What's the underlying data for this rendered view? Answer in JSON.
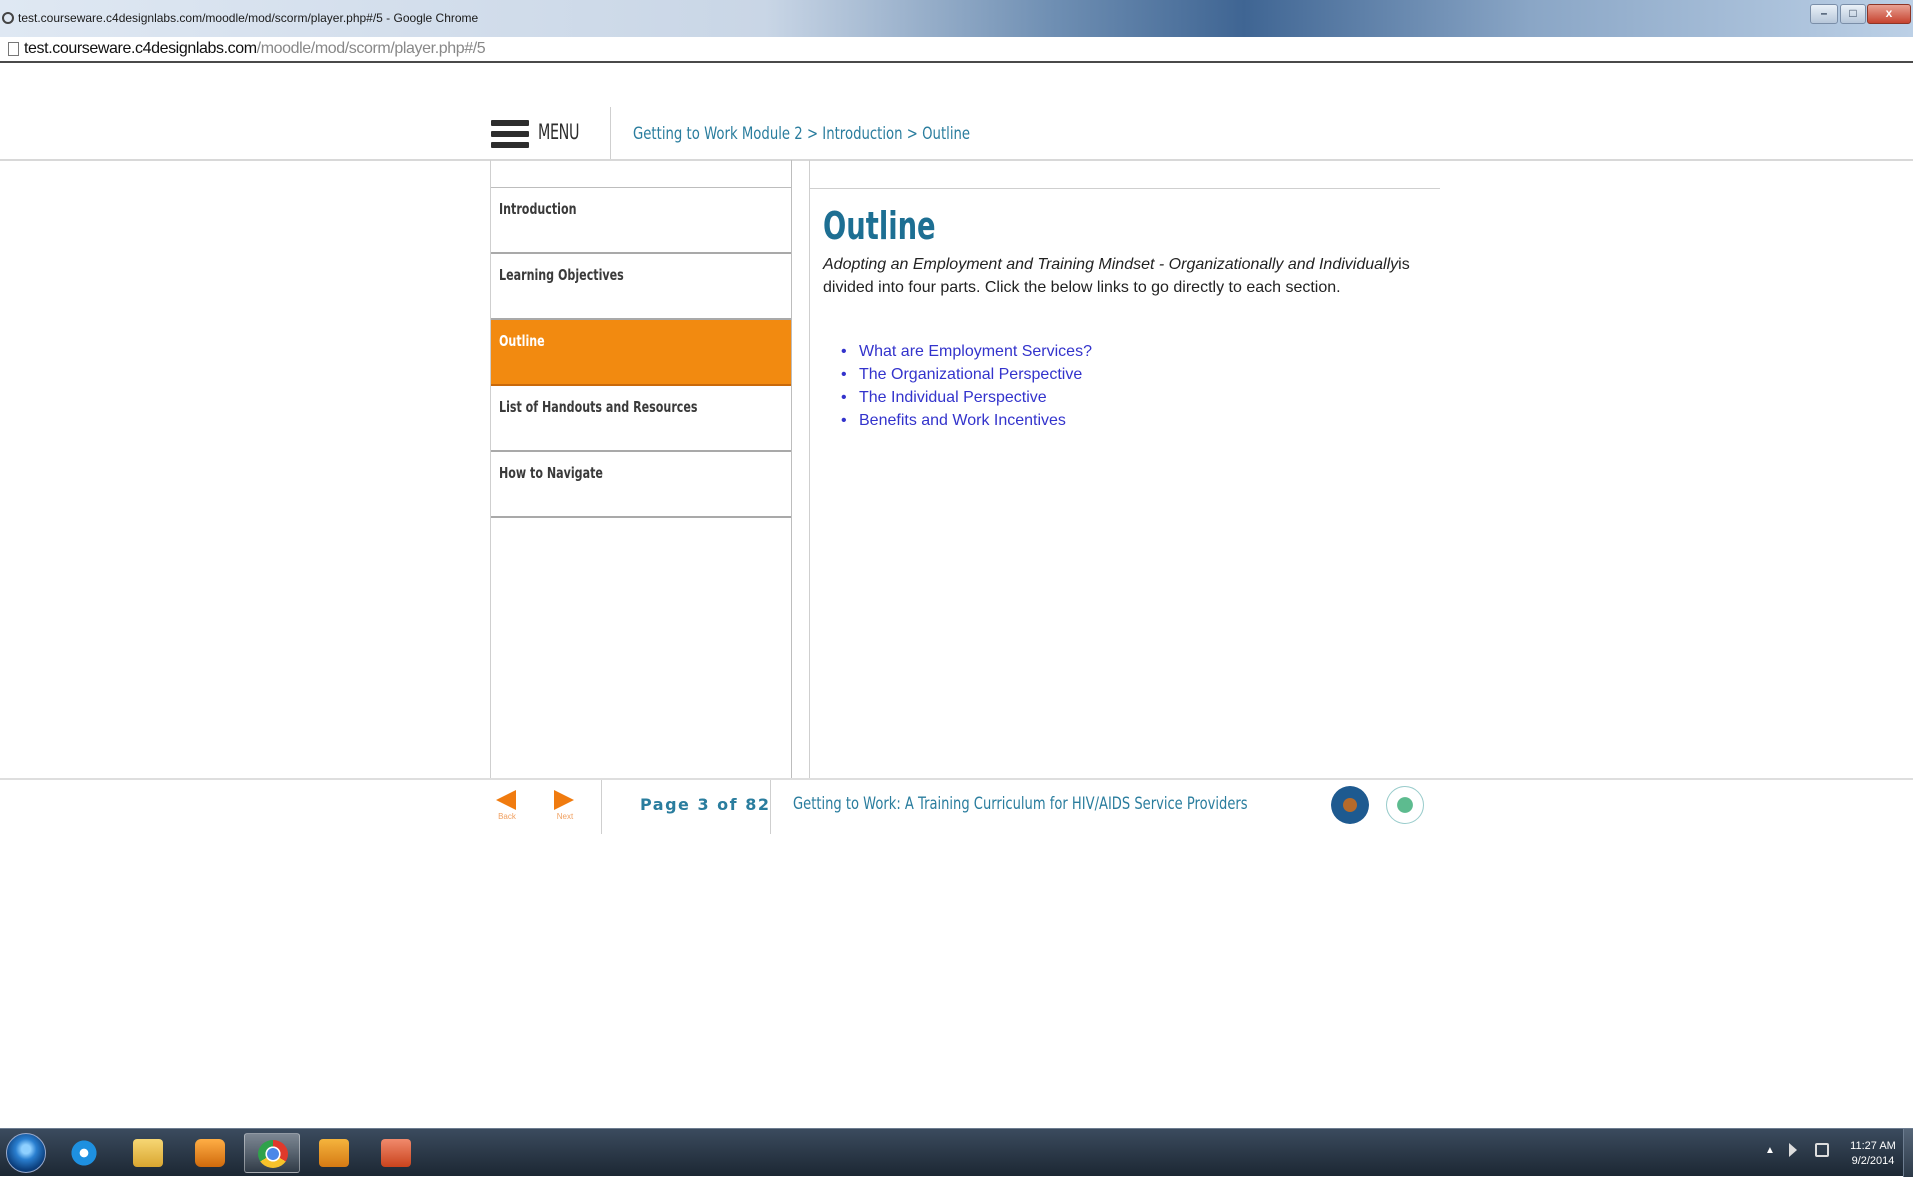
{
  "browser": {
    "window_title": "test.courseware.c4designlabs.com/moodle/mod/scorm/player.php#/5 - Google Chrome",
    "url_host": "test.courseware.c4designlabs.com",
    "url_path": "/moodle/mod/scorm/player.php#/5",
    "controls": {
      "minimize": "–",
      "maximize": "□",
      "close": "x"
    }
  },
  "header": {
    "menu_label": "MENU",
    "breadcrumb": "Getting to Work Module 2 > Introduction > Outline"
  },
  "sidebar": {
    "items": [
      {
        "label": "Introduction",
        "active": false
      },
      {
        "label": "Learning Objectives",
        "active": false
      },
      {
        "label": "Outline",
        "active": true
      },
      {
        "label": "List of Handouts and Resources",
        "active": false
      },
      {
        "label": "How to Navigate",
        "active": false
      }
    ]
  },
  "content": {
    "title": "Outline",
    "intro_italic": "Adopting an Employment and Training Mindset - Organizationally and Individually",
    "intro_rest": "is divided into four parts. Click the below links to go directly to each section.",
    "links": [
      "What are Employment Services?",
      "The Organizational Perspective",
      "The Individual Perspective",
      "Benefits and Work Incentives"
    ]
  },
  "footer": {
    "back_label": "Back",
    "next_label": "Next",
    "page_indicator": "Page 3 of 82",
    "course_title": "Getting to Work: A Training Curriculum for HIV/AIDS Service Providers",
    "seals": [
      "department-of-labor-seal",
      "hhs-seal"
    ]
  },
  "taskbar": {
    "apps": [
      "internet-explorer",
      "windows-explorer",
      "media-player",
      "google-chrome",
      "outlook",
      "powerpoint"
    ],
    "clock_time": "11:27 AM",
    "clock_date": "9/2/2014"
  },
  "colors": {
    "accent_orange": "#f28a10",
    "heading_teal": "#1d6f93",
    "link_blue": "#3333cc"
  }
}
